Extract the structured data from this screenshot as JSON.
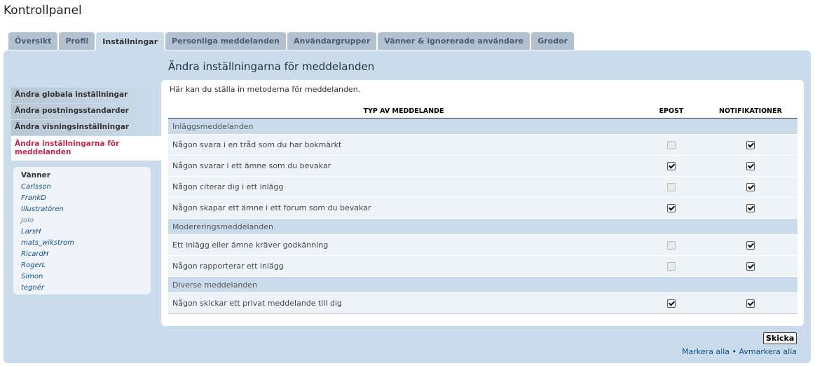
{
  "page_title": "Kontrollpanel",
  "tabs": [
    {
      "label": "Översikt"
    },
    {
      "label": "Profil"
    },
    {
      "label": "Inställningar"
    },
    {
      "label": "Personliga meddelanden"
    },
    {
      "label": "Användargrupper"
    },
    {
      "label": "Vänner & ignorerade användare"
    },
    {
      "label": "Grodor"
    }
  ],
  "sidebar": {
    "items": [
      {
        "label": "Ändra globala inställningar"
      },
      {
        "label": "Ändra postningsstandarder"
      },
      {
        "label": "Ändra visningsinställningar"
      },
      {
        "label": "Ändra inställningarna för meddelanden"
      }
    ]
  },
  "friends": {
    "title": "Vänner",
    "list": [
      "Carlsson",
      "FrankD",
      "Illustratören",
      "Jolo",
      "LarsH",
      "mats_wikstrom",
      "RicardH",
      "RogerL",
      "Simon",
      "tegnér"
    ]
  },
  "main": {
    "heading": "Ändra inställningarna för meddelanden",
    "intro": "Här kan du ställa in metoderna för meddelanden.",
    "columns": {
      "type": "TYP AV MEDDELANDE",
      "email": "EPOST",
      "notif": "NOTIFIKATIONER"
    },
    "sections": [
      {
        "title": "Inläggsmeddelanden",
        "rows": [
          {
            "label": "Någon svara i en tråd som du har bokmärkt",
            "email": false,
            "notif": true
          },
          {
            "label": "Någon svarar i ett ämne som du bevakar",
            "email": true,
            "notif": true
          },
          {
            "label": "Någon citerar dig i ett inlägg",
            "email": false,
            "notif": true
          },
          {
            "label": "Någon skapar ett ämne i ett forum som du bevakar",
            "email": true,
            "notif": true
          }
        ]
      },
      {
        "title": "Modereringsmeddelanden",
        "rows": [
          {
            "label": "Ett inlägg eller ämne kräver godkänning",
            "email": false,
            "notif": true
          },
          {
            "label": "Någon rapporterar ett inlägg",
            "email": false,
            "notif": true
          }
        ]
      },
      {
        "title": "Diverse meddelanden",
        "rows": [
          {
            "label": "Någon skickar ett privat meddelande till dig",
            "email": true,
            "notif": true
          }
        ]
      }
    ]
  },
  "footer": {
    "submit_label": "Skicka",
    "mark_all": "Markera alla",
    "separator": "•",
    "unmark_all": "Avmarkera alla"
  }
}
